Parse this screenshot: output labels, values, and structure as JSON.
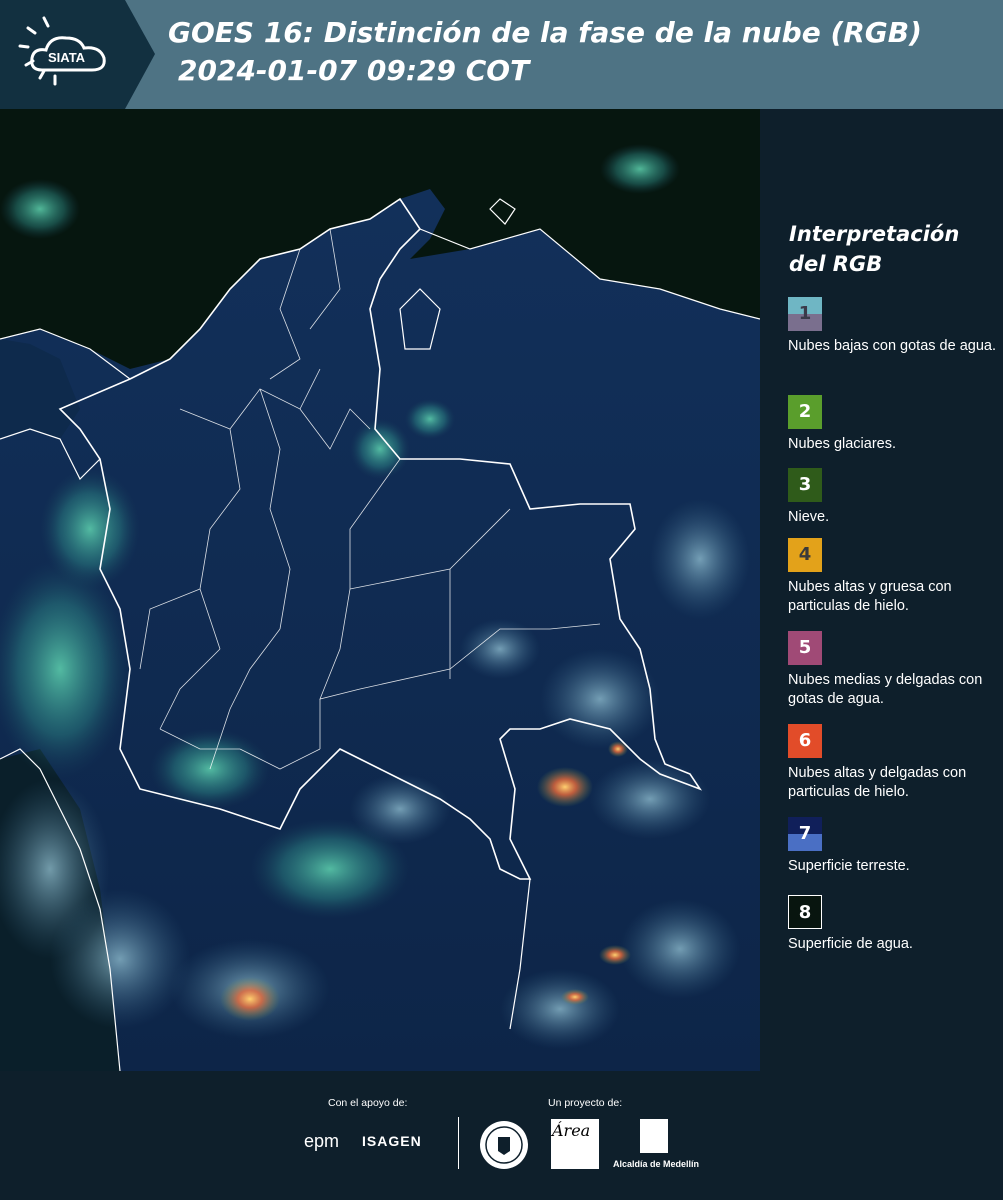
{
  "header": {
    "logo_text": "SIATA",
    "title_line1": "GOES 16: Distinción de la fase de la nube (RGB)",
    "title_line2": "2024-01-07 09:29 COT"
  },
  "legend": {
    "title": "Interpretación del RGB",
    "items": [
      {
        "number": "1",
        "label": "Nubes bajas con gotas de agua.",
        "color_top": "#6fb6c4",
        "color_bottom": "#7a6f8e"
      },
      {
        "number": "2",
        "label": "Nubes glaciares.",
        "color_top": "#5a9e2c",
        "color_bottom": "#5a9e2c"
      },
      {
        "number": "3",
        "label": "Nieve.",
        "color_top": "#2f5b1a",
        "color_bottom": "#2f5b1a"
      },
      {
        "number": "4",
        "label": "Nubes altas y gruesa con particulas de hielo.",
        "color_top": "#e3a21a",
        "color_bottom": "#e3a21a"
      },
      {
        "number": "5",
        "label": "Nubes medias y delgadas con gotas de agua.",
        "color_top": "#a04a76",
        "color_bottom": "#a04a76"
      },
      {
        "number": "6",
        "label": "Nubes altas y delgadas con particulas de hielo.",
        "color_top": "#e24c29",
        "color_bottom": "#e24c29"
      },
      {
        "number": "7",
        "label": "Superficie terreste.",
        "color_top": "#101f5a",
        "color_bottom": "#4a6fc4"
      },
      {
        "number": "8",
        "label": "Superficie de agua.",
        "color_top": "#08150f",
        "color_bottom": "#08150f"
      }
    ]
  },
  "footer": {
    "support_label": "Con el apoyo de:",
    "project_label": "Un proyecto de:",
    "sponsor1": "epm",
    "sponsor2": "ISAGEN",
    "partner1": "Área",
    "partner2": "Alcaldía de Medellín"
  },
  "colors": {
    "header_bg": "#4e7384",
    "logo_bg": "#123040",
    "page_bg": "#0e1f2b",
    "land": "#0f2a52",
    "water": "#05140f"
  }
}
